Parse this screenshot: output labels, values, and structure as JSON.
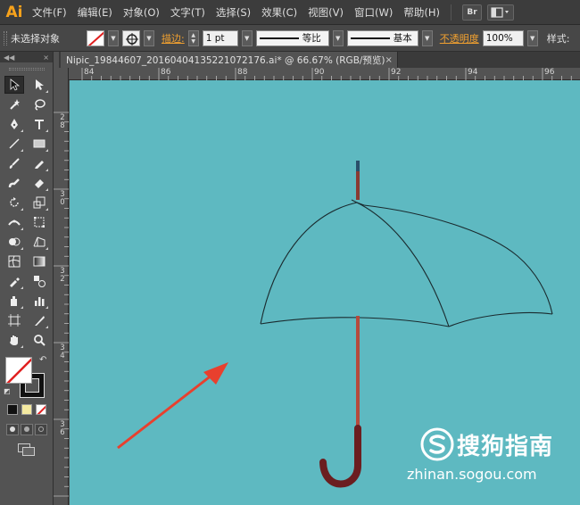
{
  "app": {
    "logo": "Ai"
  },
  "menu": {
    "items": [
      "文件(F)",
      "编辑(E)",
      "对象(O)",
      "文字(T)",
      "选择(S)",
      "效果(C)",
      "视图(V)",
      "窗口(W)",
      "帮助(H)"
    ],
    "bridge_label": "Br"
  },
  "control": {
    "selection_status": "未选择对象",
    "stroke_label": "描边:",
    "stroke_weight": "1 pt",
    "profile_label": "等比",
    "brush_label": "基本",
    "opacity_label": "不透明度",
    "opacity_value": "100%",
    "style_label": "样式:"
  },
  "document": {
    "tab_title": "Nipic_19844607_20160404135221072176.ai* @ 66.67% (RGB/预览)",
    "close_glyph": "×"
  },
  "ruler": {
    "h_labels": [
      "84",
      "86",
      "88",
      "90",
      "92",
      "94",
      "96"
    ],
    "v_labels": [
      [
        "2",
        "8"
      ],
      [
        "3",
        "0"
      ],
      [
        "3",
        "2"
      ],
      [
        "3",
        "4"
      ],
      [
        "3",
        "6"
      ]
    ]
  },
  "watermark": {
    "name": "搜狗指南",
    "url": "zhinan.sogou.com"
  },
  "colors": {
    "canvas": "#5eb9c1",
    "umbrella_shaft": "#b64a3c",
    "umbrella_handle": "#6b1e20",
    "arrow": "#e8402e",
    "accent": "#f7a21b"
  }
}
